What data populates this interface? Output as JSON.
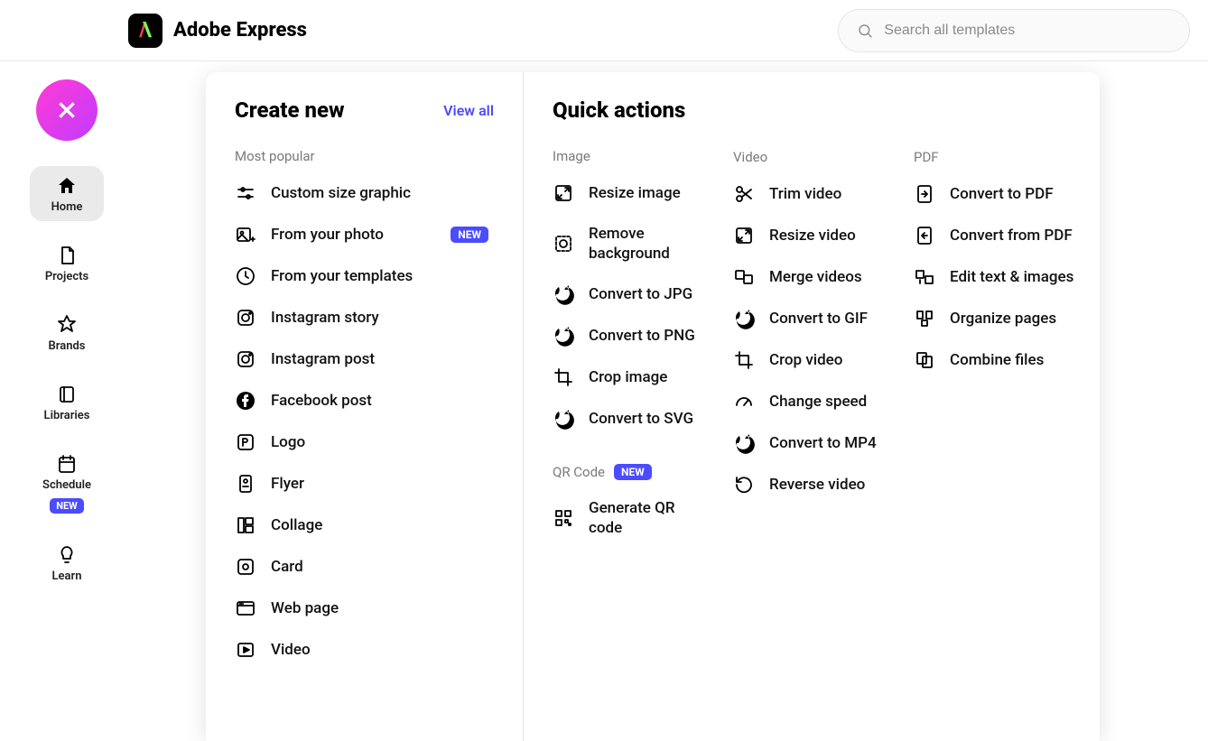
{
  "brand": {
    "title": "Adobe Express"
  },
  "search": {
    "placeholder": "Search all templates"
  },
  "sidebar": {
    "items": [
      {
        "label": "Home",
        "active": true
      },
      {
        "label": "Projects"
      },
      {
        "label": "Brands"
      },
      {
        "label": "Libraries"
      },
      {
        "label": "Schedule",
        "badge": "NEW"
      },
      {
        "label": "Learn"
      }
    ]
  },
  "createNew": {
    "title": "Create new",
    "viewAll": "View all",
    "sub": "Most popular",
    "items": [
      {
        "label": "Custom size graphic"
      },
      {
        "label": "From your photo",
        "badge": "NEW"
      },
      {
        "label": "From your templates"
      },
      {
        "label": "Instagram story"
      },
      {
        "label": "Instagram post"
      },
      {
        "label": "Facebook post"
      },
      {
        "label": "Logo"
      },
      {
        "label": "Flyer"
      },
      {
        "label": "Collage"
      },
      {
        "label": "Card"
      },
      {
        "label": "Web page"
      },
      {
        "label": "Video"
      }
    ]
  },
  "quickActions": {
    "title": "Quick actions",
    "image": {
      "sub": "Image",
      "items": [
        {
          "label": "Resize image"
        },
        {
          "label": "Remove background"
        },
        {
          "label": "Convert to JPG"
        },
        {
          "label": "Convert to PNG"
        },
        {
          "label": "Crop image"
        },
        {
          "label": "Convert to SVG"
        }
      ],
      "qrSub": "QR Code",
      "qrBadge": "NEW",
      "qrItems": [
        {
          "label": "Generate QR code"
        }
      ]
    },
    "video": {
      "sub": "Video",
      "items": [
        {
          "label": "Trim video"
        },
        {
          "label": "Resize video"
        },
        {
          "label": "Merge videos"
        },
        {
          "label": "Convert to GIF"
        },
        {
          "label": "Crop video"
        },
        {
          "label": "Change speed"
        },
        {
          "label": "Convert to MP4"
        },
        {
          "label": "Reverse video"
        }
      ]
    },
    "pdf": {
      "sub": "PDF",
      "items": [
        {
          "label": "Convert to PDF"
        },
        {
          "label": "Convert from PDF"
        },
        {
          "label": "Edit text & images"
        },
        {
          "label": "Organize pages"
        },
        {
          "label": "Combine files"
        }
      ]
    }
  }
}
